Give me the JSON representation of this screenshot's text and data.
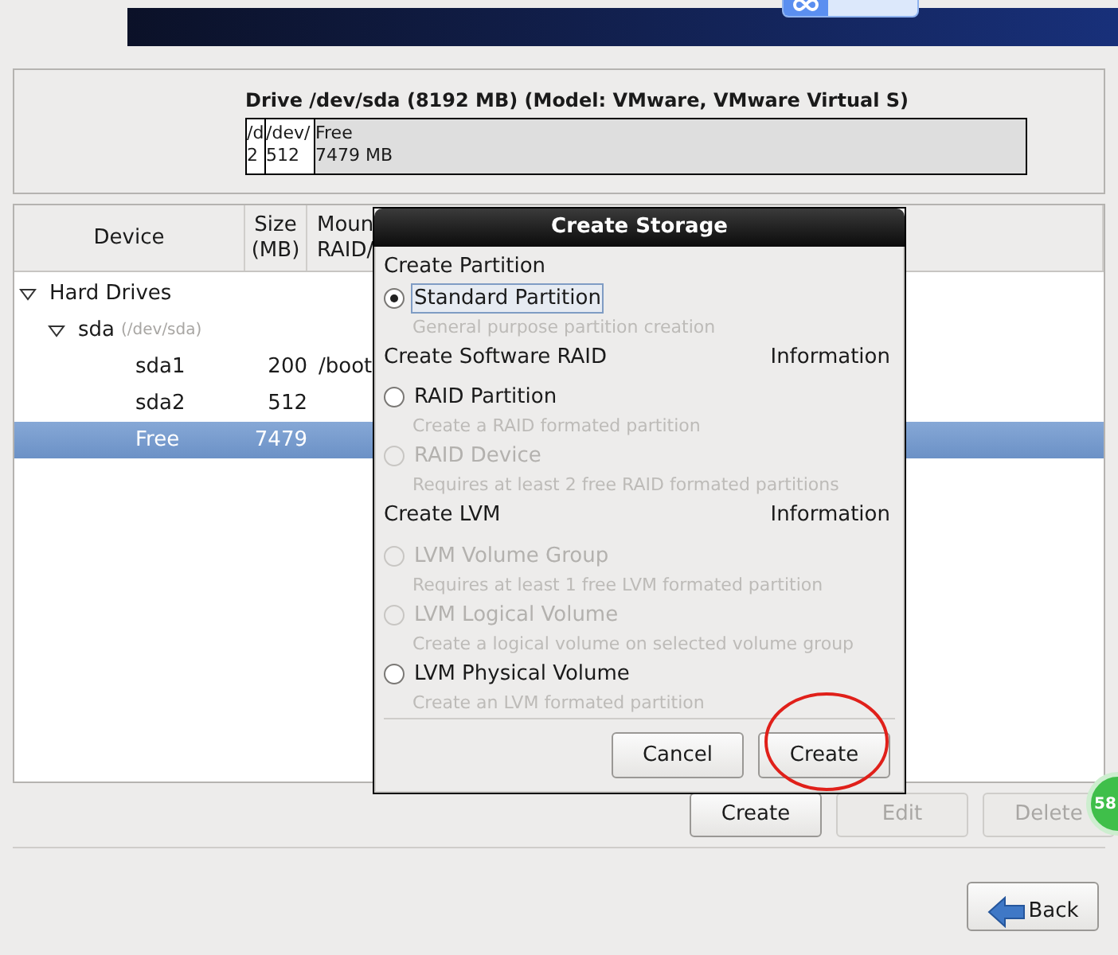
{
  "drive": {
    "title": "Drive /dev/sda (8192 MB) (Model: VMware, VMware Virtual S)",
    "segments": [
      {
        "name": "/d",
        "size": "2",
        "free": false
      },
      {
        "name": "/dev/",
        "size": "512",
        "free": false
      },
      {
        "name": "Free",
        "size": "7479 MB",
        "free": true
      }
    ]
  },
  "table": {
    "columns": [
      {
        "lines": [
          "Device"
        ]
      },
      {
        "lines": [
          "Size",
          "(MB)"
        ]
      },
      {
        "lines": [
          "Moun",
          "RAID/"
        ]
      }
    ],
    "rows": [
      {
        "device": "Hard Drives",
        "expanded": true,
        "selected": false,
        "children": [
          {
            "device": "sda",
            "note": "(/dev/sda)",
            "expanded": true,
            "selected": false,
            "children": [
              {
                "device": "sda1",
                "size": "200",
                "mount": "/boot",
                "selected": false
              },
              {
                "device": "sda2",
                "size": "512",
                "selected": false
              },
              {
                "device": "Free",
                "size": "7479",
                "selected": true
              }
            ]
          }
        ]
      }
    ]
  },
  "dialog": {
    "title": "Create Storage",
    "sections": [
      {
        "heading": "Create Partition",
        "options": [
          {
            "label": "Standard Partition",
            "description": "General purpose partition creation",
            "selected": true,
            "disabled": false
          }
        ]
      },
      {
        "heading": "Create Software RAID",
        "info": "Information",
        "options": [
          {
            "label": "RAID Partition",
            "description": "Create a RAID formated partition",
            "selected": false,
            "disabled": false
          },
          {
            "label": "RAID Device",
            "description": "Requires at least 2 free RAID formated partitions",
            "selected": false,
            "disabled": true
          }
        ]
      },
      {
        "heading": "Create LVM",
        "info": "Information",
        "options": [
          {
            "label": "LVM Volume Group",
            "description": "Requires at least 1 free LVM formated partition",
            "selected": false,
            "disabled": true
          },
          {
            "label": "LVM Logical Volume",
            "description": "Create a logical volume on selected volume group",
            "selected": false,
            "disabled": true
          },
          {
            "label": "LVM Physical Volume",
            "description": "Create an LVM formated partition",
            "selected": false,
            "disabled": false
          }
        ]
      }
    ],
    "buttons": [
      {
        "label": "Cancel",
        "circled": false
      },
      {
        "label": "Create",
        "circled": true
      }
    ]
  },
  "actions": [
    {
      "label": "Create",
      "disabled": false
    },
    {
      "label": "Edit",
      "disabled": true
    },
    {
      "label": "Delete",
      "disabled": true
    }
  ],
  "badge": {
    "text": "58"
  },
  "nav": [
    {
      "label": "Back"
    }
  ]
}
